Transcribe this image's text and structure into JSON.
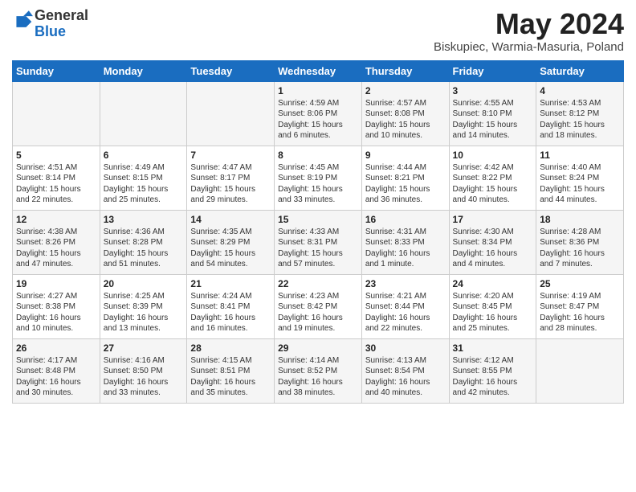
{
  "header": {
    "logo_general": "General",
    "logo_blue": "Blue",
    "month_title": "May 2024",
    "location": "Biskupiec, Warmia-Masuria, Poland"
  },
  "weekdays": [
    "Sunday",
    "Monday",
    "Tuesday",
    "Wednesday",
    "Thursday",
    "Friday",
    "Saturday"
  ],
  "weeks": [
    [
      {
        "day": "",
        "info": ""
      },
      {
        "day": "",
        "info": ""
      },
      {
        "day": "",
        "info": ""
      },
      {
        "day": "1",
        "info": "Sunrise: 4:59 AM\nSunset: 8:06 PM\nDaylight: 15 hours\nand 6 minutes."
      },
      {
        "day": "2",
        "info": "Sunrise: 4:57 AM\nSunset: 8:08 PM\nDaylight: 15 hours\nand 10 minutes."
      },
      {
        "day": "3",
        "info": "Sunrise: 4:55 AM\nSunset: 8:10 PM\nDaylight: 15 hours\nand 14 minutes."
      },
      {
        "day": "4",
        "info": "Sunrise: 4:53 AM\nSunset: 8:12 PM\nDaylight: 15 hours\nand 18 minutes."
      }
    ],
    [
      {
        "day": "5",
        "info": "Sunrise: 4:51 AM\nSunset: 8:14 PM\nDaylight: 15 hours\nand 22 minutes."
      },
      {
        "day": "6",
        "info": "Sunrise: 4:49 AM\nSunset: 8:15 PM\nDaylight: 15 hours\nand 25 minutes."
      },
      {
        "day": "7",
        "info": "Sunrise: 4:47 AM\nSunset: 8:17 PM\nDaylight: 15 hours\nand 29 minutes."
      },
      {
        "day": "8",
        "info": "Sunrise: 4:45 AM\nSunset: 8:19 PM\nDaylight: 15 hours\nand 33 minutes."
      },
      {
        "day": "9",
        "info": "Sunrise: 4:44 AM\nSunset: 8:21 PM\nDaylight: 15 hours\nand 36 minutes."
      },
      {
        "day": "10",
        "info": "Sunrise: 4:42 AM\nSunset: 8:22 PM\nDaylight: 15 hours\nand 40 minutes."
      },
      {
        "day": "11",
        "info": "Sunrise: 4:40 AM\nSunset: 8:24 PM\nDaylight: 15 hours\nand 44 minutes."
      }
    ],
    [
      {
        "day": "12",
        "info": "Sunrise: 4:38 AM\nSunset: 8:26 PM\nDaylight: 15 hours\nand 47 minutes."
      },
      {
        "day": "13",
        "info": "Sunrise: 4:36 AM\nSunset: 8:28 PM\nDaylight: 15 hours\nand 51 minutes."
      },
      {
        "day": "14",
        "info": "Sunrise: 4:35 AM\nSunset: 8:29 PM\nDaylight: 15 hours\nand 54 minutes."
      },
      {
        "day": "15",
        "info": "Sunrise: 4:33 AM\nSunset: 8:31 PM\nDaylight: 15 hours\nand 57 minutes."
      },
      {
        "day": "16",
        "info": "Sunrise: 4:31 AM\nSunset: 8:33 PM\nDaylight: 16 hours\nand 1 minute."
      },
      {
        "day": "17",
        "info": "Sunrise: 4:30 AM\nSunset: 8:34 PM\nDaylight: 16 hours\nand 4 minutes."
      },
      {
        "day": "18",
        "info": "Sunrise: 4:28 AM\nSunset: 8:36 PM\nDaylight: 16 hours\nand 7 minutes."
      }
    ],
    [
      {
        "day": "19",
        "info": "Sunrise: 4:27 AM\nSunset: 8:38 PM\nDaylight: 16 hours\nand 10 minutes."
      },
      {
        "day": "20",
        "info": "Sunrise: 4:25 AM\nSunset: 8:39 PM\nDaylight: 16 hours\nand 13 minutes."
      },
      {
        "day": "21",
        "info": "Sunrise: 4:24 AM\nSunset: 8:41 PM\nDaylight: 16 hours\nand 16 minutes."
      },
      {
        "day": "22",
        "info": "Sunrise: 4:23 AM\nSunset: 8:42 PM\nDaylight: 16 hours\nand 19 minutes."
      },
      {
        "day": "23",
        "info": "Sunrise: 4:21 AM\nSunset: 8:44 PM\nDaylight: 16 hours\nand 22 minutes."
      },
      {
        "day": "24",
        "info": "Sunrise: 4:20 AM\nSunset: 8:45 PM\nDaylight: 16 hours\nand 25 minutes."
      },
      {
        "day": "25",
        "info": "Sunrise: 4:19 AM\nSunset: 8:47 PM\nDaylight: 16 hours\nand 28 minutes."
      }
    ],
    [
      {
        "day": "26",
        "info": "Sunrise: 4:17 AM\nSunset: 8:48 PM\nDaylight: 16 hours\nand 30 minutes."
      },
      {
        "day": "27",
        "info": "Sunrise: 4:16 AM\nSunset: 8:50 PM\nDaylight: 16 hours\nand 33 minutes."
      },
      {
        "day": "28",
        "info": "Sunrise: 4:15 AM\nSunset: 8:51 PM\nDaylight: 16 hours\nand 35 minutes."
      },
      {
        "day": "29",
        "info": "Sunrise: 4:14 AM\nSunset: 8:52 PM\nDaylight: 16 hours\nand 38 minutes."
      },
      {
        "day": "30",
        "info": "Sunrise: 4:13 AM\nSunset: 8:54 PM\nDaylight: 16 hours\nand 40 minutes."
      },
      {
        "day": "31",
        "info": "Sunrise: 4:12 AM\nSunset: 8:55 PM\nDaylight: 16 hours\nand 42 minutes."
      },
      {
        "day": "",
        "info": ""
      }
    ]
  ]
}
